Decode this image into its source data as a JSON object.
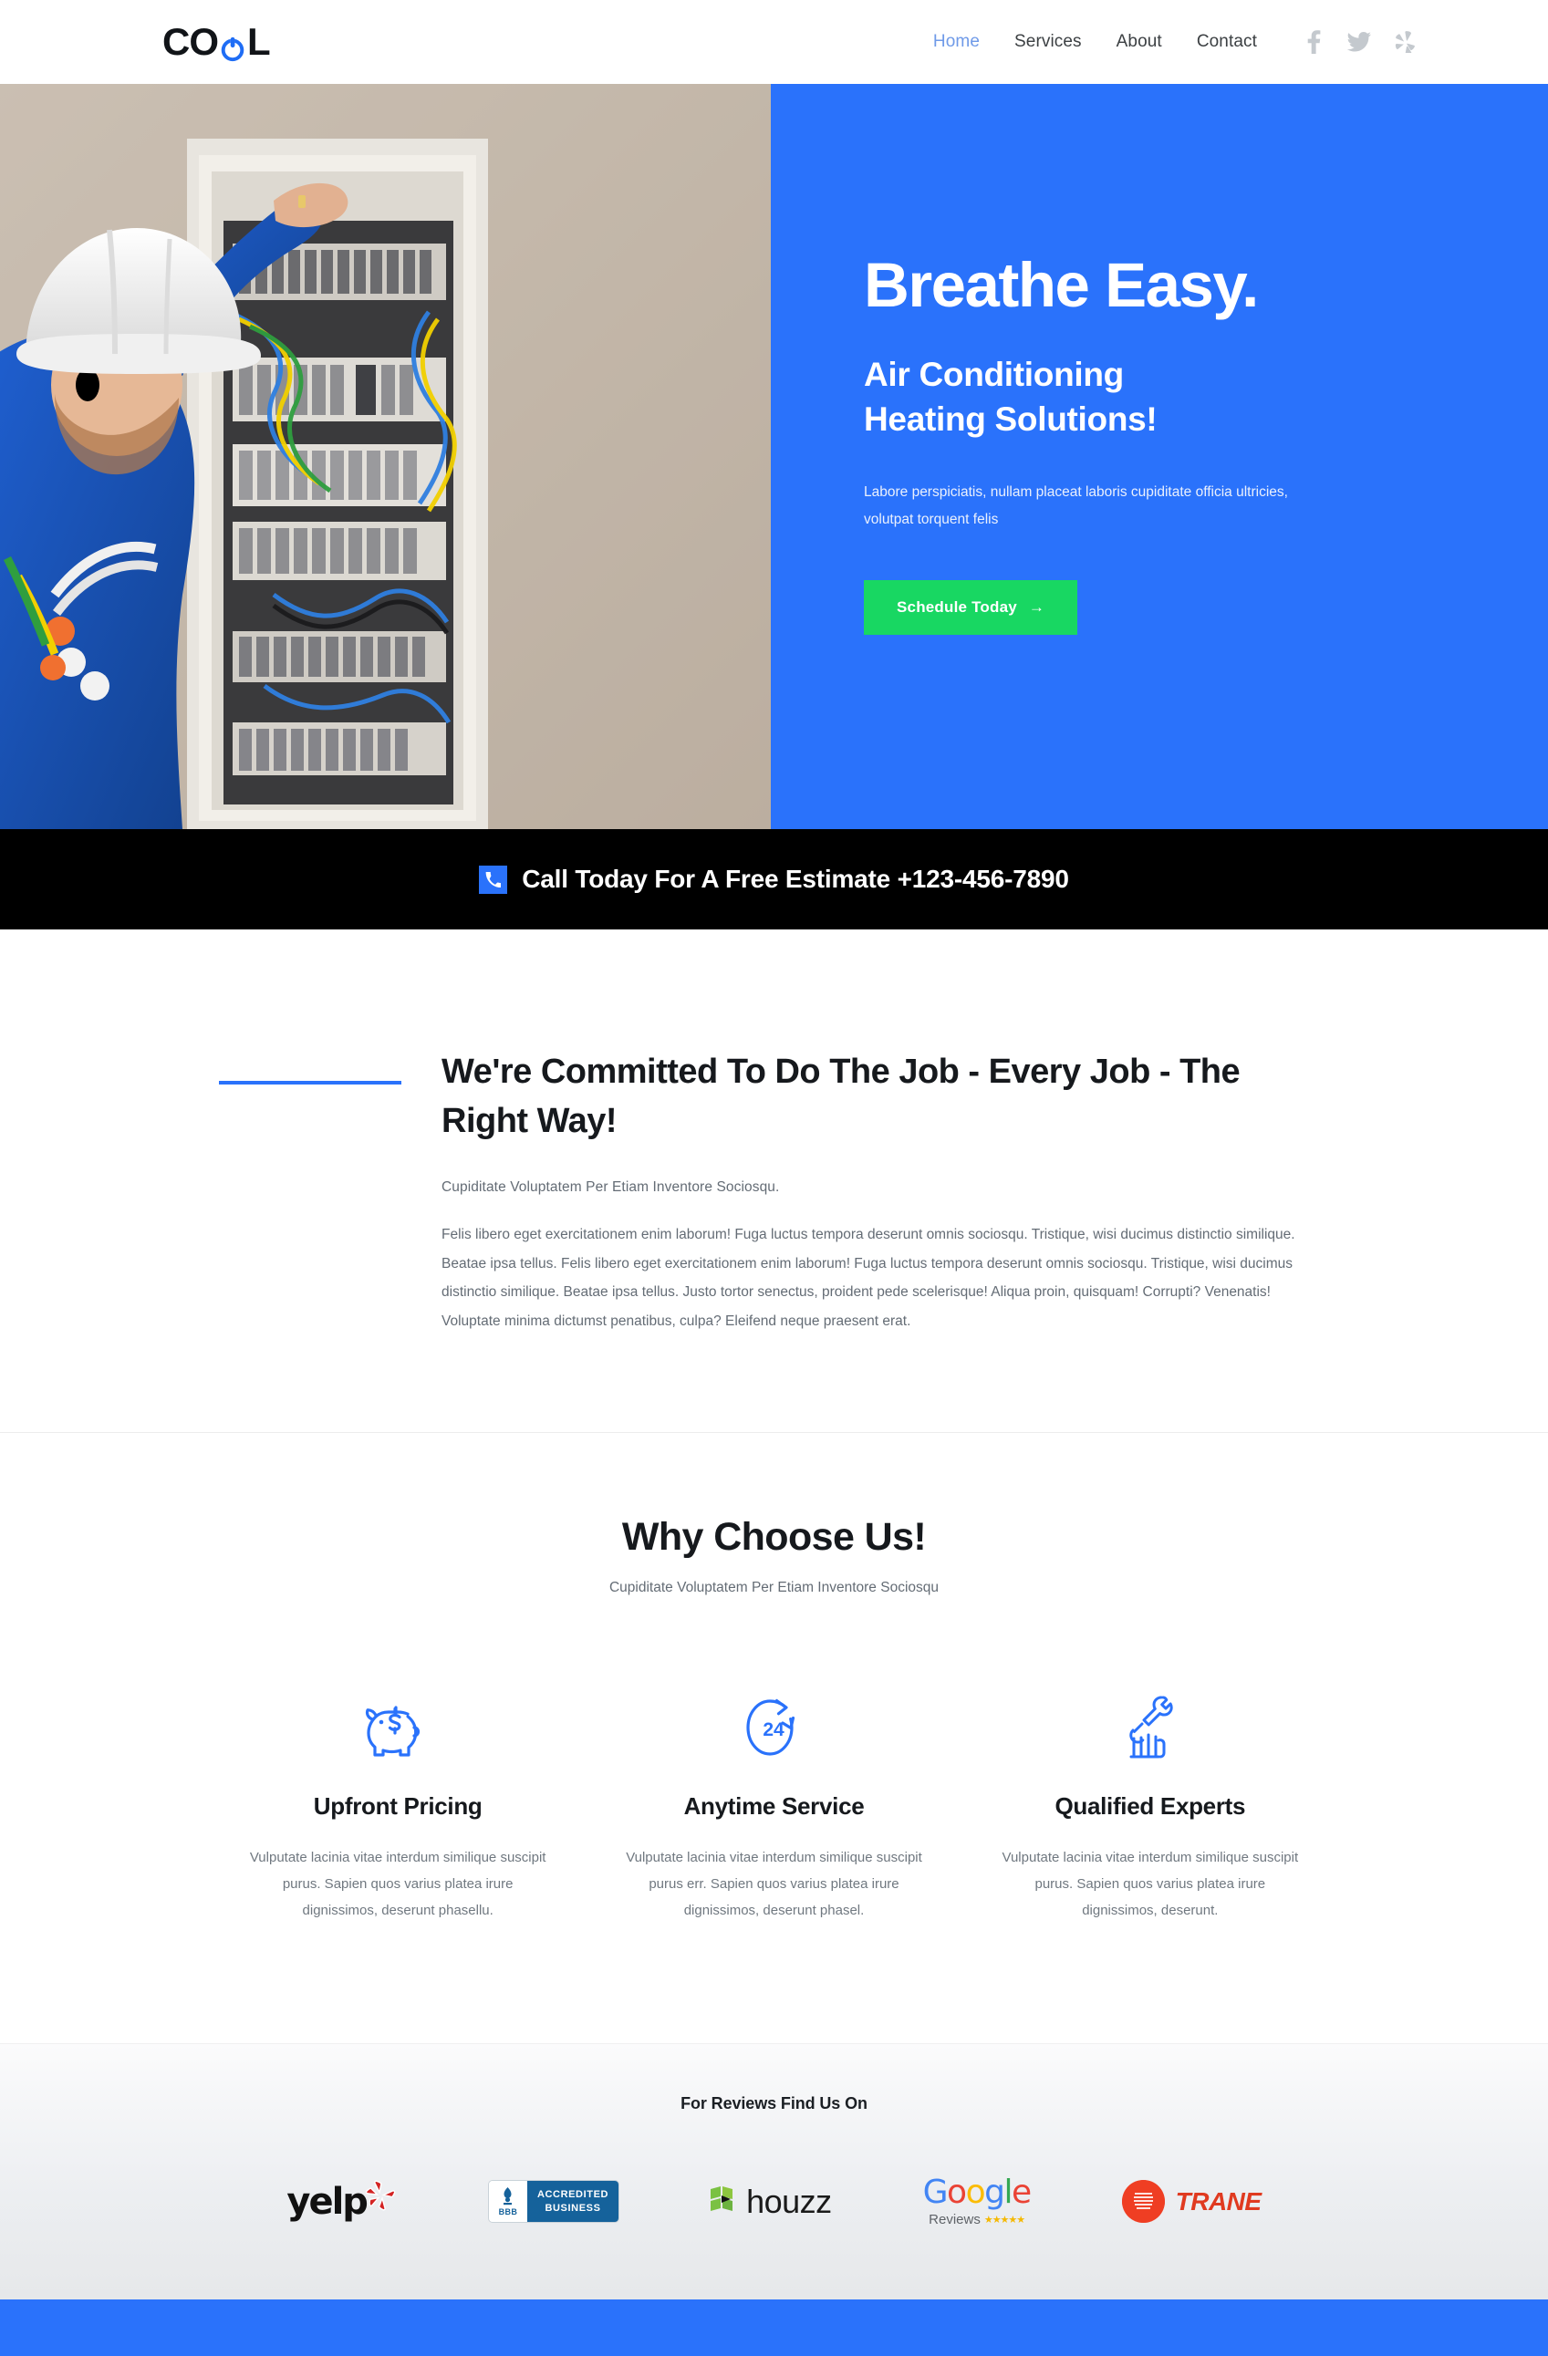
{
  "header": {
    "logo_text_1": "CO",
    "logo_text_2": "L",
    "logo_icon": "power-icon",
    "nav": [
      {
        "label": "Home",
        "active": true
      },
      {
        "label": "Services",
        "active": false
      },
      {
        "label": "About",
        "active": false
      },
      {
        "label": "Contact",
        "active": false
      }
    ],
    "social": [
      {
        "name": "facebook-icon",
        "glyph": "f"
      },
      {
        "name": "twitter-icon",
        "glyph": "t"
      },
      {
        "name": "yelp-icon",
        "glyph": "y"
      }
    ]
  },
  "hero": {
    "image_alt": "technician-inspecting-electrical-panel",
    "title": "Breathe Easy.",
    "subtitle_line1": "Air Conditioning",
    "subtitle_line2": "Heating Solutions!",
    "paragraph": "Labore perspiciatis, nullam placeat laboris cupiditate officia ultricies, volutpat torquent felis",
    "cta_label": "Schedule Today",
    "cta_arrow": "→",
    "bg_color": "#2a72fb",
    "cta_color": "#18d762"
  },
  "callbar": {
    "icon": "phone-icon",
    "text": "Call Today For A Free Estimate +123-456-7890",
    "bg_color": "#000000",
    "icon_color": "#2a72fb"
  },
  "committed": {
    "heading": "We're Committed To Do The Job - Every Job - The Right Way!",
    "subheading": "Cupiditate Voluptatem Per Etiam Inventore Sociosqu.",
    "paragraph": "Felis libero eget exercitationem enim laborum! Fuga luctus tempora deserunt omnis sociosqu. Tristique, wisi ducimus distinctio similique. Beatae ipsa tellus. Felis libero eget exercitationem enim laborum! Fuga luctus tempora deserunt omnis sociosqu. Tristique, wisi ducimus distinctio similique. Beatae ipsa tellus. Justo tortor senectus, proident pede scelerisque! Aliqua proin, quisquam! Corrupti? Venenatis! Voluptate minima dictumst penatibus, culpa? Eleifend neque praesent erat.",
    "rule_color": "#2a72fb"
  },
  "why": {
    "heading": "Why Choose Us!",
    "subheading": "Cupiditate Voluptatem Per Etiam Inventore Sociosqu",
    "cards": [
      {
        "icon": "piggy-bank-dollar-icon",
        "title": "Upfront Pricing",
        "text": "Vulputate lacinia vitae interdum similique suscipit purus. Sapien quos varius platea irure dignissimos, deserunt phasellu."
      },
      {
        "icon": "24-hours-clock-icon",
        "badge": "24",
        "title": "Anytime Service",
        "text": "Vulputate lacinia vitae interdum similique suscipit purus err. Sapien quos varius platea irure dignissimos, deserunt phasel."
      },
      {
        "icon": "hand-holding-wrench-icon",
        "title": "Qualified Experts",
        "text": "Vulputate lacinia vitae interdum similique suscipit purus. Sapien quos varius platea irure dignissimos, deserunt."
      }
    ],
    "icon_color": "#2a72fb"
  },
  "reviews": {
    "heading": "For Reviews Find Us On",
    "logos": [
      {
        "name": "yelp-logo",
        "text": "yelp"
      },
      {
        "name": "bbb-accredited-business-logo",
        "abbr": "BBB",
        "line1": "ACCREDITED",
        "line2": "BUSINESS"
      },
      {
        "name": "houzz-logo",
        "text": "houzz"
      },
      {
        "name": "google-reviews-logo",
        "text": "Google",
        "sub": "Reviews",
        "stars": "★★★★★"
      },
      {
        "name": "trane-logo",
        "text": "TRANE"
      }
    ]
  },
  "footer": {
    "bg_color": "#2a72fb"
  }
}
